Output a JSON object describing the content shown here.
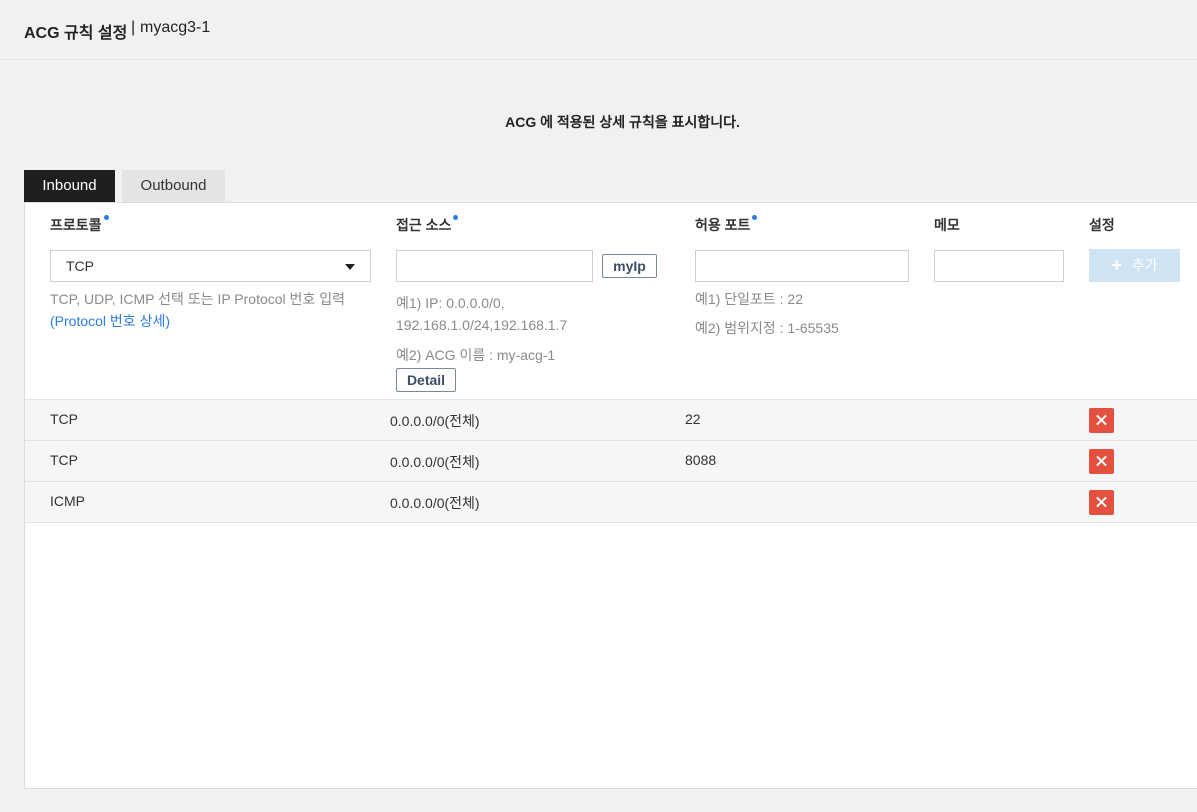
{
  "header": {
    "title": "ACG 규칙 설정",
    "separator": "|",
    "acg_name": "myacg3-1"
  },
  "description": "ACG 에 적용된 상세 규칙을 표시합니다.",
  "tabs": [
    {
      "label": "Inbound",
      "active": true
    },
    {
      "label": "Outbound",
      "active": false
    }
  ],
  "columns": {
    "protocol": "프로토콜",
    "source": "접근 소스",
    "port": "허용 포트",
    "memo": "메모",
    "settings": "설정"
  },
  "form": {
    "protocol_selected": "TCP",
    "protocol_hint": "TCP, UDP, ICMP 선택 또는 IP Protocol 번호 입력",
    "protocol_link_open": "(",
    "protocol_link": "Protocol 번호 상세",
    "protocol_link_close": ")",
    "source_value": "",
    "myip_button": "myIp",
    "source_hint_1a": "예1) IP: 0.0.0.0/0,",
    "source_hint_1b": "192.168.1.0/24,192.168.1.7",
    "source_hint_2": "예2) ACG 이름 : my-acg-1",
    "detail_button": "Detail",
    "port_value": "",
    "port_hint_1": "예1) 단일포트 : 22",
    "port_hint_2": "예2) 범위지정 : 1-65535",
    "memo_value": "",
    "add_button": "추가"
  },
  "rules": [
    {
      "protocol": "TCP",
      "source": "0.0.0.0/0(전체)",
      "port": "22"
    },
    {
      "protocol": "TCP",
      "source": "0.0.0.0/0(전체)",
      "port": "8088"
    },
    {
      "protocol": "ICMP",
      "source": "0.0.0.0/0(전체)",
      "port": ""
    }
  ],
  "colors": {
    "tab_active_bg": "#1f1f1f",
    "accent_blue": "#2a7de1",
    "delete_red": "#e3503f",
    "add_button_bg": "#cfe3f3"
  }
}
